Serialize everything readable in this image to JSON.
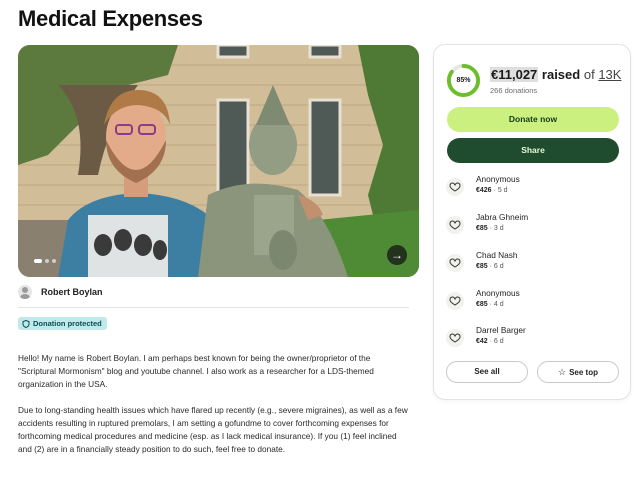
{
  "page": {
    "title": "Medical Expenses"
  },
  "hero": {
    "next_glyph": "→"
  },
  "organizer": {
    "name": "Robert Boylan"
  },
  "badge": {
    "label": "Donation protected"
  },
  "story": {
    "paragraphs": [
      "Hello! My name is Robert Boylan. I am perhaps best known for being the owner/proprietor of the \"Scriptural Mormonism\" blog and youtube channel. I also work as a researcher for a LDS-themed organization in the USA.",
      "Due to long-standing health issues which have flared up recently (e.g., severe migraines), as well as a few accidents resulting in ruptured premolars, I am setting a gofundme to cover forthcoming expenses for forthcoming medical procedures and medicine (esp. as I lack medical insurance). If you (1) feel inclined and (2) are in a financially steady position to do such, feel free to donate."
    ]
  },
  "campaign": {
    "progress_label": "85%",
    "progress_fraction": 0.85,
    "raised_amount": "€11,027",
    "raised_word": "raised",
    "of_word": "of",
    "goal": "13K",
    "donations_count": "266 donations",
    "donate_label": "Donate now",
    "share_label": "Share",
    "accent_color": "#6cbf2a"
  },
  "donors": [
    {
      "name": "Anonymous",
      "amount": "€426",
      "time": "5 d"
    },
    {
      "name": "Jabra Ghneim",
      "amount": "€85",
      "time": "3 d"
    },
    {
      "name": "Chad Nash",
      "amount": "€85",
      "time": "6 d"
    },
    {
      "name": "Anonymous",
      "amount": "€85",
      "time": "4 d"
    },
    {
      "name": "Darrel Barger",
      "amount": "€42",
      "time": "6 d"
    }
  ],
  "actions": {
    "see_all": "See all",
    "see_top": "See top"
  }
}
